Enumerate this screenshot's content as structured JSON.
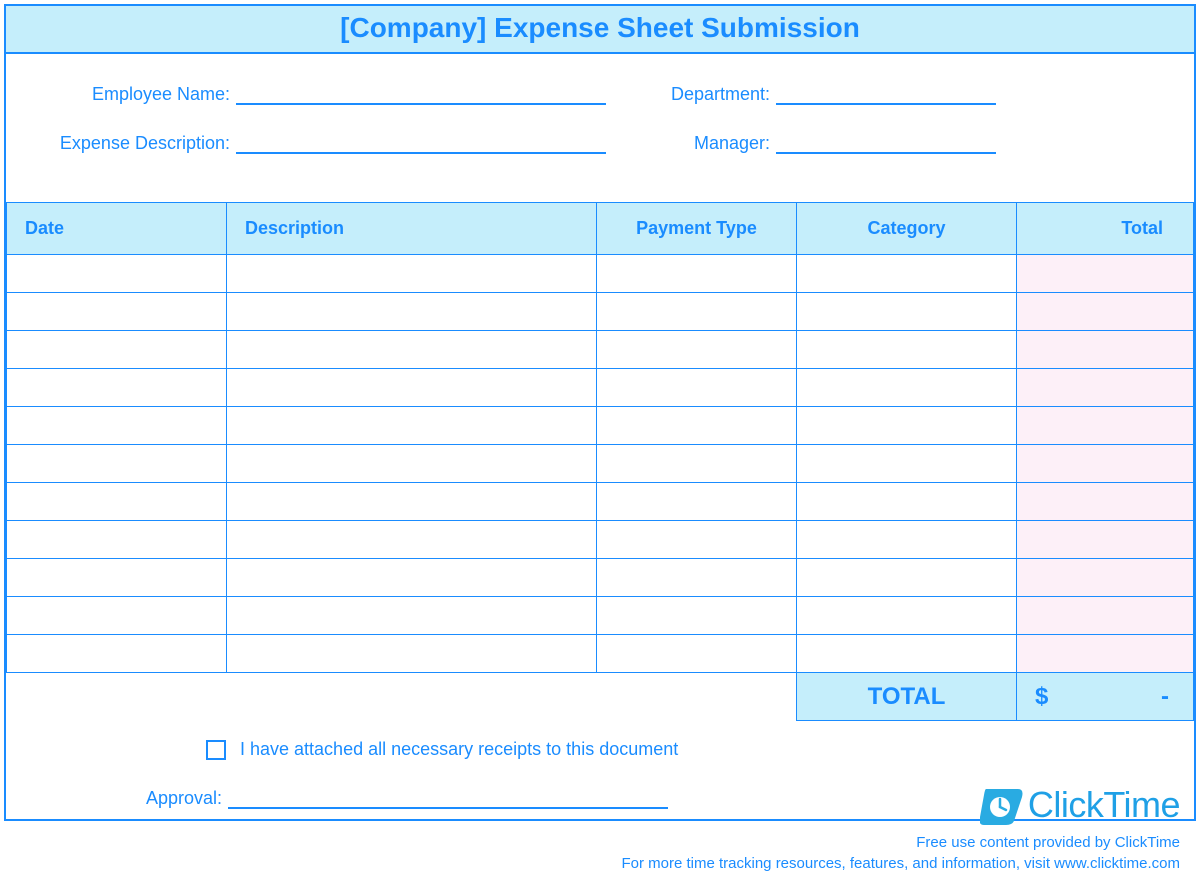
{
  "title": "[Company] Expense Sheet Submission",
  "fields": {
    "employee_name": {
      "label": "Employee Name:",
      "value": ""
    },
    "department": {
      "label": "Department:",
      "value": ""
    },
    "expense_description": {
      "label": "Expense Description:",
      "value": ""
    },
    "manager": {
      "label": "Manager:",
      "value": ""
    }
  },
  "columns": {
    "date": "Date",
    "description": "Description",
    "payment_type": "Payment Type",
    "category": "Category",
    "total": "Total"
  },
  "rows": [
    {
      "date": "",
      "description": "",
      "payment_type": "",
      "category": "",
      "total": ""
    },
    {
      "date": "",
      "description": "",
      "payment_type": "",
      "category": "",
      "total": ""
    },
    {
      "date": "",
      "description": "",
      "payment_type": "",
      "category": "",
      "total": ""
    },
    {
      "date": "",
      "description": "",
      "payment_type": "",
      "category": "",
      "total": ""
    },
    {
      "date": "",
      "description": "",
      "payment_type": "",
      "category": "",
      "total": ""
    },
    {
      "date": "",
      "description": "",
      "payment_type": "",
      "category": "",
      "total": ""
    },
    {
      "date": "",
      "description": "",
      "payment_type": "",
      "category": "",
      "total": ""
    },
    {
      "date": "",
      "description": "",
      "payment_type": "",
      "category": "",
      "total": ""
    },
    {
      "date": "",
      "description": "",
      "payment_type": "",
      "category": "",
      "total": ""
    },
    {
      "date": "",
      "description": "",
      "payment_type": "",
      "category": "",
      "total": ""
    },
    {
      "date": "",
      "description": "",
      "payment_type": "",
      "category": "",
      "total": ""
    }
  ],
  "summary": {
    "label": "TOTAL",
    "currency": "$",
    "value": "-"
  },
  "receipts_checkbox": {
    "checked": false,
    "label": "I have attached all necessary receipts to this document"
  },
  "approval": {
    "label": "Approval:",
    "value": ""
  },
  "branding": {
    "logo_text": "ClickTime",
    "credit1": "Free use content provided by ClickTime",
    "credit2": "For more time tracking resources, features, and information, visit www.clicktime.com"
  }
}
